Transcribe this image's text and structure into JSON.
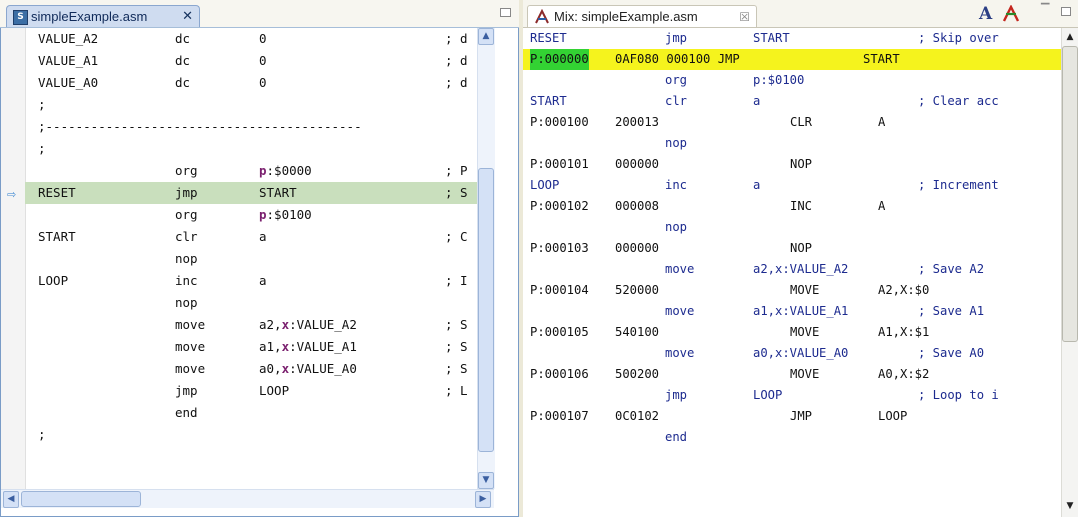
{
  "left_editor": {
    "tab_title": "simpleExample.asm",
    "tab_close": "✕",
    "lines": [
      {
        "c0": "VALUE_A2",
        "c1": "dc",
        "c2": "0",
        "c3": "; d"
      },
      {
        "c0": "VALUE_A1",
        "c1": "dc",
        "c2": "0",
        "c3": "; d"
      },
      {
        "c0": "VALUE_A0",
        "c1": "dc",
        "c2": "0",
        "c3": "; d"
      },
      {
        "c0": ";",
        "c1": "",
        "c2": "",
        "c3": ""
      },
      {
        "c0": ";------------------------------------------",
        "c1": "",
        "c2": "",
        "c3": ""
      },
      {
        "c0": ";",
        "c1": "",
        "c2": "",
        "c3": ""
      },
      {
        "c1": "org",
        "c2a": "p",
        "c2b": ":$0000",
        "c3": "; P"
      },
      {
        "c0": "RESET",
        "c1": "jmp",
        "c2": "START",
        "c3": "; S"
      },
      {
        "c1": "org",
        "c2a": "p",
        "c2b": ":$0100",
        "c3": ""
      },
      {
        "c0": "START",
        "c1": "clr",
        "c2": "a",
        "c3": "; C"
      },
      {
        "c1": "nop"
      },
      {
        "c0": "LOOP",
        "c1": "inc",
        "c2": "a",
        "c3": "; I"
      },
      {
        "c1": "nop"
      },
      {
        "c1": "move",
        "c2a": "a2,",
        "c2k": "x",
        "c2b": ":VALUE_A2",
        "c3": "; S"
      },
      {
        "c1": "move",
        "c2a": "a1,",
        "c2k": "x",
        "c2b": ":VALUE_A1",
        "c3": "; S"
      },
      {
        "c1": "move",
        "c2a": "a0,",
        "c2k": "x",
        "c2b": ":VALUE_A0",
        "c3": "; S"
      },
      {
        "c1": "jmp",
        "c2": "LOOP",
        "c3": "; L"
      },
      {
        "c1": "end"
      },
      {
        "c0": ";"
      }
    ]
  },
  "mix_view": {
    "tab_title": "Mix: simpleExample.asm",
    "tab_close": "☒",
    "font_button": "A",
    "lines": [
      {
        "type": "src",
        "c0": "RESET",
        "c1": "jmp",
        "c2": "START",
        "c3": "; Skip over"
      },
      {
        "type": "dis",
        "pc": "P:000000",
        "op": "0AF080 000100 JMP",
        "arg": "START",
        "yellow": true
      },
      {
        "type": "src",
        "c1": "org",
        "c2": "p:$0100"
      },
      {
        "type": "src",
        "c0": "START",
        "c1": "clr",
        "c2": "a",
        "c3": "; Clear acc"
      },
      {
        "type": "dis",
        "pc": "P:000100",
        "op": "200013",
        "mn": "CLR",
        "arg": "A"
      },
      {
        "type": "src",
        "c1": "nop"
      },
      {
        "type": "dis",
        "pc": "P:000101",
        "op": "000000",
        "mn": "NOP",
        "arg": ""
      },
      {
        "type": "src",
        "c0": "LOOP",
        "c1": "inc",
        "c2": "a",
        "c3": "; Increment"
      },
      {
        "type": "dis",
        "pc": "P:000102",
        "op": "000008",
        "mn": "INC",
        "arg": "A"
      },
      {
        "type": "src",
        "c1": "nop"
      },
      {
        "type": "dis",
        "pc": "P:000103",
        "op": "000000",
        "mn": "NOP",
        "arg": ""
      },
      {
        "type": "src",
        "c1": "move",
        "c2": "a2,x:VALUE_A2",
        "c3": "; Save A2"
      },
      {
        "type": "dis",
        "pc": "P:000104",
        "op": "520000",
        "mn": "MOVE",
        "arg": "A2,X:$0"
      },
      {
        "type": "src",
        "c1": "move",
        "c2": "a1,x:VALUE_A1",
        "c3": "; Save A1"
      },
      {
        "type": "dis",
        "pc": "P:000105",
        "op": "540100",
        "mn": "MOVE",
        "arg": "A1,X:$1"
      },
      {
        "type": "src",
        "c1": "move",
        "c2": "a0,x:VALUE_A0",
        "c3": "; Save A0"
      },
      {
        "type": "dis",
        "pc": "P:000106",
        "op": "500200",
        "mn": "MOVE",
        "arg": "A0,X:$2"
      },
      {
        "type": "src",
        "c1": "jmp",
        "c2": "LOOP",
        "c3": "; Loop to i"
      },
      {
        "type": "dis",
        "pc": "P:000107",
        "op": "0C0102",
        "mn": "JMP",
        "arg": "LOOP"
      },
      {
        "type": "src",
        "c1": "end"
      }
    ]
  },
  "icons": {
    "file_icon": "asm-file-icon",
    "mix_icon": "mix-view-icon",
    "debug_pointer": "instruction-pointer-icon",
    "font_icon": "font-icon",
    "filter_icon": "filter-icon"
  },
  "colors": {
    "current_line_highlight": "#c9dfbd",
    "mix_pc_highlight": "#f5f31d",
    "mix_pc_address": "#33d233",
    "source_text": "#1d2b8f",
    "keyword_purple": "#7a1f6e"
  }
}
